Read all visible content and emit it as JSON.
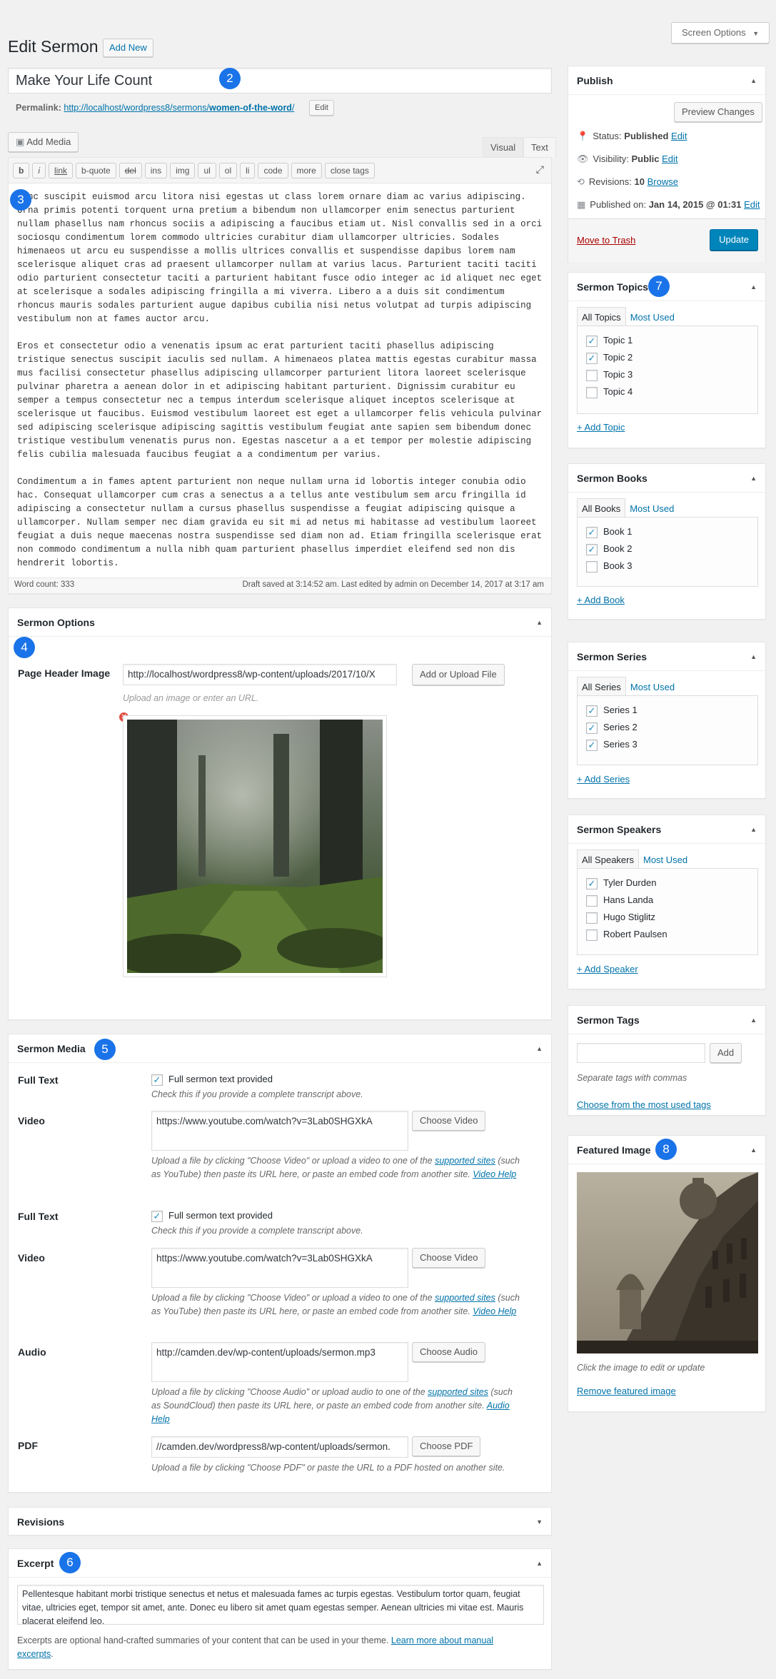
{
  "page": {
    "title": "Edit Sermon",
    "add_new": "Add New",
    "screen_options": "Screen Options"
  },
  "post": {
    "title": "Make Your Life Count",
    "permalink_label": "Permalink:",
    "permalink_base": "http://localhost/wordpress8/sermons/",
    "permalink_slug": "women-of-the-word",
    "permalink_end": "/",
    "permalink_edit": "Edit"
  },
  "editor": {
    "add_media": "Add Media",
    "tab_visual": "Visual",
    "tab_text": "Text",
    "quicktags": [
      "b",
      "i",
      "link",
      "b-quote",
      "del",
      "ins",
      "img",
      "ul",
      "ol",
      "li",
      "code",
      "more",
      "close tags"
    ],
    "paragraphs": [
      "Nunc suscipit euismod arcu litora nisi egestas ut class lorem ornare diam ac varius adipiscing. Urna primis potenti torquent urna pretium a bibendum non ullamcorper enim senectus parturient nullam phasellus nam rhoncus sociis a adipiscing a faucibus etiam ut. Nisl convallis sed in a orci sociosqu condimentum lorem commodo ultricies curabitur diam ullamcorper ultricies. Sodales himenaeos ut arcu eu suspendisse a mollis ultrices convallis et suspendisse dapibus lorem nam scelerisque aliquet cras ad praesent ullamcorper nullam at varius lacus. Parturient taciti taciti odio parturient consectetur taciti a parturient habitant fusce odio integer ac id aliquet nec eget at scelerisque a sodales adipiscing fringilla a mi viverra. Libero a a duis sit condimentum rhoncus mauris sodales parturient augue dapibus cubilia nisi netus volutpat ad turpis adipiscing vestibulum non at fames auctor arcu.",
      "Eros et consectetur odio a venenatis ipsum ac erat parturient taciti phasellus adipiscing tristique senectus suscipit iaculis sed nullam. A himenaeos platea mattis egestas curabitur massa mus facilisi consectetur phasellus adipiscing ullamcorper parturient litora laoreet scelerisque pulvinar pharetra a aenean dolor in et adipiscing habitant parturient. Dignissim curabitur eu semper a tempus consectetur nec a tempus interdum scelerisque aliquet inceptos scelerisque at scelerisque ut faucibus. Euismod vestibulum laoreet est eget a ullamcorper felis vehicula pulvinar sed adipiscing scelerisque adipiscing sagittis vestibulum feugiat ante sapien sem bibendum donec tristique vestibulum venenatis purus non. Egestas nascetur a a et tempor per molestie adipiscing felis cubilia malesuada faucibus feugiat a a condimentum per varius.",
      "Condimentum a in fames aptent parturient non neque nullam urna id lobortis integer conubia odio hac. Consequat ullamcorper cum cras a senectus a a tellus ante vestibulum sem arcu fringilla id adipiscing a consectetur nullam a cursus phasellus suspendisse a feugiat adipiscing quisque a ullamcorper. Nullam semper nec diam gravida eu sit mi ad netus mi habitasse ad vestibulum laoreet feugiat a duis neque maecenas nostra suspendisse sed diam non ad. Etiam fringilla scelerisque erat non commodo condimentum a nulla nibh quam parturient phasellus imperdiet eleifend sed non dis hendrerit lobortis."
    ],
    "word_count": "Word count: 333",
    "draft_saved": "Draft saved at 3:14:52 am. Last edited by admin on December 14, 2017 at 3:17 am"
  },
  "sermon_options": {
    "title": "Sermon Options",
    "page_header_label": "Page Header Image",
    "page_header_value": "http://localhost/wordpress8/wp-content/uploads/2017/10/X",
    "upload_button": "Add or Upload File",
    "upload_help": "Upload an image or enter an URL."
  },
  "sermon_media": {
    "title": "Sermon Media",
    "full_text_label": "Full Text",
    "full_text_checkbox": "Full sermon text provided",
    "full_text_help": "Check this if you provide a complete transcript above.",
    "video_label": "Video",
    "video_value": "https://www.youtube.com/watch?v=3Lab0SHGXkA",
    "video_button": "Choose Video",
    "video_help_1": "Upload a file by clicking \"Choose Video\" or upload a video to one of the ",
    "video_help_link": "supported sites",
    "video_help_2": " (such as YouTube) then paste its URL here, or paste an embed code from another site. ",
    "video_help_link2": "Video Help",
    "audio_label": "Audio",
    "audio_value": "http://camden.dev/wp-content/uploads/sermon.mp3",
    "audio_button": "Choose Audio",
    "audio_help_1": "Upload a file by clicking \"Choose Audio\" or upload audio to one of the ",
    "audio_help_link": "supported sites",
    "audio_help_2": " (such as SoundCloud) then paste its URL here, or paste an embed code from another site. ",
    "audio_help_link2": "Audio Help",
    "pdf_label": "PDF",
    "pdf_value": "//camden.dev/wordpress8/wp-content/uploads/sermon.",
    "pdf_button": "Choose PDF",
    "pdf_help": "Upload a file by clicking \"Choose PDF\" or paste the URL to a PDF hosted on another site."
  },
  "revisions_box": {
    "title": "Revisions"
  },
  "excerpt": {
    "title": "Excerpt",
    "value": "Pellentesque habitant morbi tristique senectus et netus et malesuada fames ac turpis egestas. Vestibulum tortor quam, feugiat vitae, ultricies eget, tempor sit amet, ante. Donec eu libero sit amet quam egestas semper. Aenean ultricies mi vitae est. Mauris placerat eleifend leo.",
    "help_1": "Excerpts are optional hand-crafted summaries of your content that can be used in your theme. ",
    "help_link": "Learn more about manual excerpts",
    "help_2": "."
  },
  "publish": {
    "title": "Publish",
    "preview": "Preview Changes",
    "status_label": "Status:",
    "status_value": "Published",
    "visibility_label": "Visibility:",
    "visibility_value": "Public",
    "revisions_label": "Revisions:",
    "revisions_value": "10",
    "browse": "Browse",
    "published_label": "Published on:",
    "published_value": "Jan 14, 2015 @ 01:31",
    "edit": "Edit",
    "trash": "Move to Trash",
    "update": "Update"
  },
  "topics": {
    "title": "Sermon Topics",
    "tab_all": "All Topics",
    "tab_most": "Most Used",
    "items": [
      {
        "label": "Topic 1",
        "checked": true
      },
      {
        "label": "Topic 2",
        "checked": true
      },
      {
        "label": "Topic 3",
        "checked": false
      },
      {
        "label": "Topic 4",
        "checked": false
      }
    ],
    "add": "+ Add Topic"
  },
  "books": {
    "title": "Sermon Books",
    "tab_all": "All Books",
    "tab_most": "Most Used",
    "items": [
      {
        "label": "Book 1",
        "checked": true
      },
      {
        "label": "Book 2",
        "checked": true
      },
      {
        "label": "Book 3",
        "checked": false
      }
    ],
    "add": "+ Add Book"
  },
  "series": {
    "title": "Sermon Series",
    "tab_all": "All Series",
    "tab_most": "Most Used",
    "items": [
      {
        "label": "Series 1",
        "checked": true
      },
      {
        "label": "Series 2",
        "checked": true
      },
      {
        "label": "Series 3",
        "checked": true
      }
    ],
    "add": "+ Add Series"
  },
  "speakers": {
    "title": "Sermon Speakers",
    "tab_all": "All Speakers",
    "tab_most": "Most Used",
    "items": [
      {
        "label": "Tyler Durden",
        "checked": true
      },
      {
        "label": "Hans Landa",
        "checked": false
      },
      {
        "label": "Hugo Stiglitz",
        "checked": false
      },
      {
        "label": "Robert Paulsen",
        "checked": false
      }
    ],
    "add": "+ Add Speaker"
  },
  "tags": {
    "title": "Sermon Tags",
    "add": "Add",
    "help": "Separate tags with commas",
    "choose": "Choose from the most used tags"
  },
  "featured": {
    "title": "Featured Image",
    "help": "Click the image to edit or update",
    "remove": "Remove featured image"
  },
  "markers": [
    "2",
    "3",
    "4",
    "5",
    "6",
    "7",
    "8"
  ],
  "colors": {
    "accent": "#0073aa",
    "primary_button": "#0085ba",
    "marker": "#1a73e8",
    "trash": "#a00"
  }
}
